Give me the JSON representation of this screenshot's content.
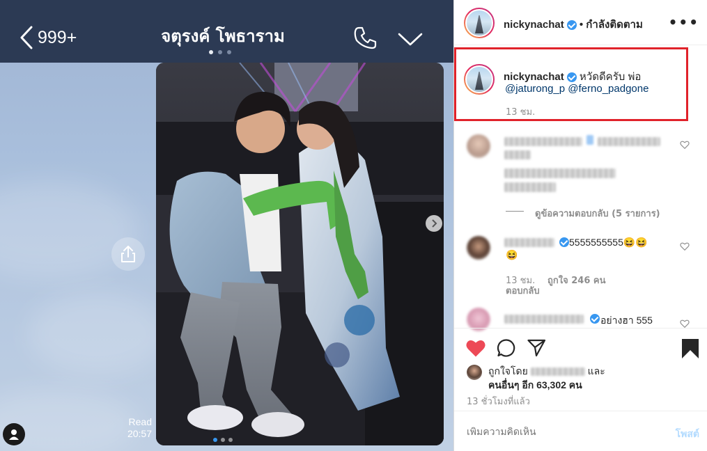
{
  "chat": {
    "back_label": "999+",
    "title": "จตุรงค์ โพธาราม",
    "read_label": "Read",
    "time": "20:57"
  },
  "instagram": {
    "username": "nickynachat",
    "follow_status": "• กำลังติดตาม",
    "more_icon": "•••",
    "caption": {
      "username": "nickynachat",
      "text": "หวัดดีครับ พ่อ",
      "mentions": "@jaturong_p @ferno_padgone",
      "time": "13 ชม."
    },
    "view_replies": "ดูข้อความตอบกลับ (5 รายการ)",
    "comment2": {
      "text": "5555555555😆😆",
      "emoji2": "😆",
      "time": "13 ชม.",
      "likes": "ถูกใจ 246 คน",
      "reply": "ตอบกลับ"
    },
    "comment3": {
      "text": "อย่างฮา 555"
    },
    "liked_by_prefix": "ถูกใจโดย",
    "liked_by_and": "และ",
    "liked_by_others": "คนอื่นๆ อีก 63,302 คน",
    "post_time": "13 ชั่วโมงที่แล้ว",
    "comment_placeholder": "เพิ่มความคิดเห็น",
    "post_button": "โพสต์"
  },
  "colors": {
    "chat_header": "#2c3a54",
    "verified": "#3897f0",
    "heart_liked": "#ed4956",
    "highlight_box": "#e0222a"
  }
}
